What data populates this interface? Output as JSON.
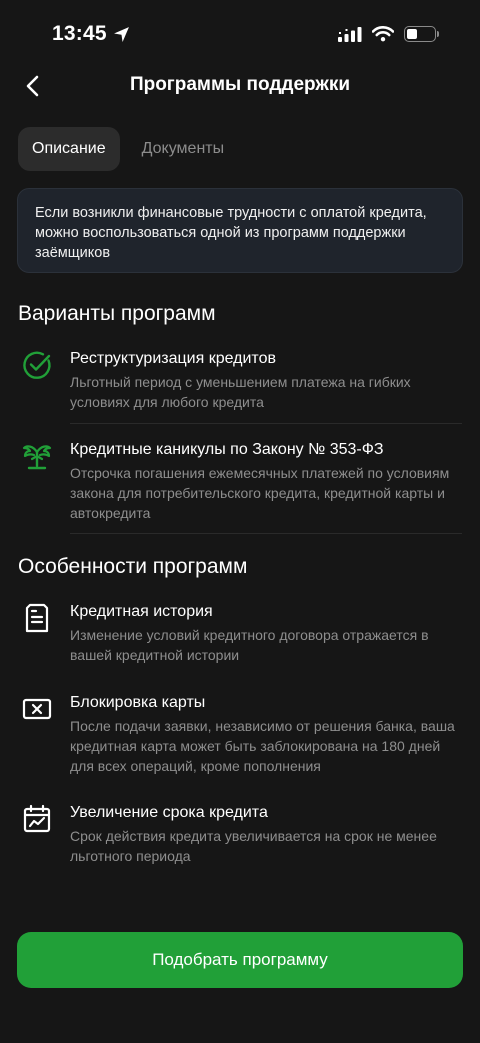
{
  "status_bar": {
    "time": "13:45"
  },
  "header": {
    "title": "Программы поддержки"
  },
  "tabs": [
    {
      "label": "Описание",
      "active": true
    },
    {
      "label": "Документы",
      "active": false
    }
  ],
  "info_text": "Если возникли финансовые трудности с оплатой кредита, можно воспользоваться одной из программ поддержки заёмщиков",
  "programs": {
    "title": "Варианты программ",
    "items": [
      {
        "icon": "check-circle-icon",
        "title": "Реструктуризация кредитов",
        "description": "Льготный период с уменьшением платежа на гибких условиях для любого кредита"
      },
      {
        "icon": "palm-tree-icon",
        "title": "Кредитные каникулы по Закону № 353-ФЗ",
        "description": "Отсрочка погашения ежемесячных платежей по условиям закона для потребительского кредита, кредитной карты и автокредита"
      }
    ]
  },
  "features": {
    "title": "Особенности программ",
    "items": [
      {
        "icon": "document-icon",
        "title": "Кредитная история",
        "description": "Изменение условий кредитного договора отражается в вашей кредитной истории"
      },
      {
        "icon": "card-block-icon",
        "title": "Блокировка карты",
        "description": "После подачи заявки, независимо от решения банка, ваша кредитная карта может быть заблокирована на 180 дней для всех операций, кроме пополнения"
      },
      {
        "icon": "calendar-icon",
        "title": "Увеличение срока кредита",
        "description": "Срок действия кредита увеличивается на срок не менее льготного периода"
      }
    ]
  },
  "cta_label": "Подобрать программу",
  "colors": {
    "accent": "#21a038",
    "background": "#161616",
    "card": "#1f242c"
  }
}
